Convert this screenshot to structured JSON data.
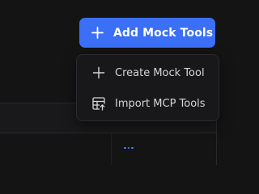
{
  "toolbar": {
    "add_button_label": "Add Mock Tools"
  },
  "dropdown": {
    "items": [
      {
        "label": "Create Mock Tool",
        "icon": "plus-icon"
      },
      {
        "label": "Import MCP Tools",
        "icon": "table-import-icon"
      }
    ]
  },
  "table": {
    "row_actions_icon": "more-horizontal-icon"
  },
  "colors": {
    "accent": "#3b6ff5",
    "background": "#141415",
    "menu_background": "#18181a",
    "menu_border": "#2c2c30",
    "menu_text": "#d6d6d8",
    "link_dots": "#4c82ff"
  }
}
